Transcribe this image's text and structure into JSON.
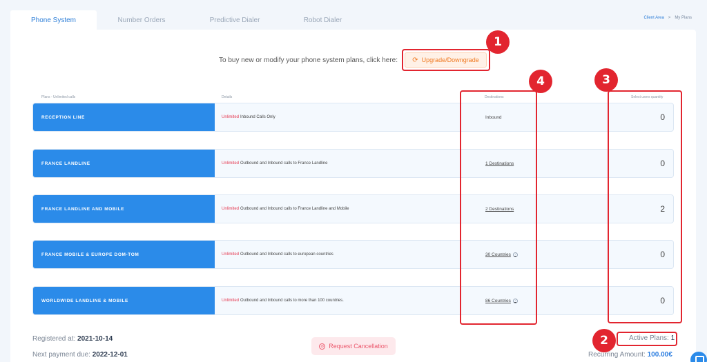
{
  "tabs": [
    {
      "label": "Phone System",
      "active": true
    },
    {
      "label": "Number Orders",
      "active": false
    },
    {
      "label": "Predictive Dialer",
      "active": false
    },
    {
      "label": "Robot Dialer",
      "active": false
    }
  ],
  "breadcrumb": {
    "link": "Client Area",
    "separator": ">",
    "current": "My Plans"
  },
  "promo": {
    "text": "To buy new or modify your phone system plans, click here:",
    "button_label": "Upgrade/Downgrade",
    "button_icon": "refresh-icon"
  },
  "table": {
    "headers": {
      "plans": "Plans - Unlimited calls",
      "details": "Details",
      "destinations": "Destinations",
      "quantity": "Select users quantity"
    },
    "rows": [
      {
        "name": "RECEPTION LINE",
        "unlimited": "Unlimited",
        "detail": "Inbound Calls Only",
        "destination": "Inbound",
        "dest_link": false,
        "dest_info": false,
        "quantity": "0"
      },
      {
        "name": "FRANCE LANDLINE",
        "unlimited": "Unlimited",
        "detail": "Outbound and Inbound calls to France Landline",
        "destination": "1 Destinations",
        "dest_link": true,
        "dest_info": false,
        "quantity": "0"
      },
      {
        "name": "FRANCE LANDLINE AND MOBILE",
        "unlimited": "Unlimited",
        "detail": "Outbound and Inbound calls to France Landline and Mobile",
        "destination": "2 Destinations",
        "dest_link": true,
        "dest_info": false,
        "quantity": "2"
      },
      {
        "name": "FRANCE MOBILE & EUROPE DOM-TOM",
        "unlimited": "Unlimited",
        "detail": "Outbound and Inbound calls to european countries",
        "destination": "30 Countries",
        "dest_link": true,
        "dest_info": true,
        "quantity": "0"
      },
      {
        "name": "WORLDWIDE LANDLINE & MOBILE",
        "unlimited": "Unlimited",
        "detail": "Outbound and Inbound calls to more than 100 countries.",
        "destination": "86 Countries",
        "dest_link": true,
        "dest_info": true,
        "quantity": "0"
      }
    ]
  },
  "annotations": [
    "1",
    "2",
    "3",
    "4"
  ],
  "footer": {
    "registered_label": "Registered at:",
    "registered_value": "2021-10-14",
    "next_payment_label": "Next payment due:",
    "next_payment_value": "2022-12-01",
    "cancel_label": "Request Cancellation",
    "active_plans_label": "Active Plans:",
    "active_plans_value": "1",
    "recurring_label": "Recurring Amount:",
    "recurring_value": "100.00€"
  },
  "colors": {
    "accent": "#2b8be9",
    "annotation": "#e2252f",
    "upgrade": "#f0781f",
    "unlimited": "#e53950"
  }
}
